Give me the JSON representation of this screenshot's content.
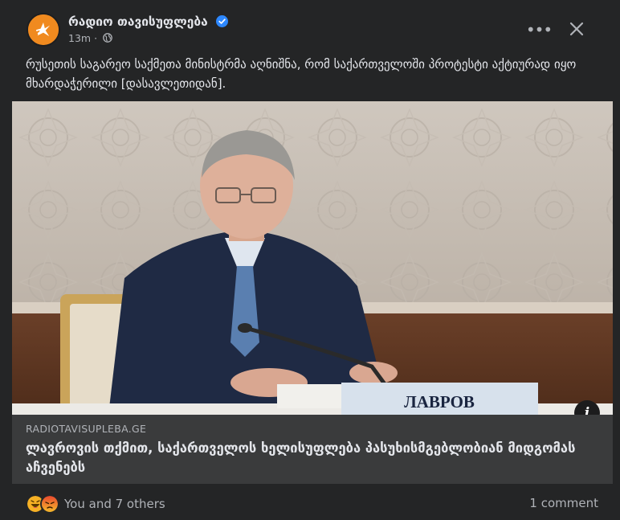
{
  "post": {
    "page_name": "რადიო თავისუფლება",
    "time": "13m",
    "privacy_icon": "globe-icon",
    "text": "რუსეთის საგარეო საქმეთა მინისტრმა აღნიშნა, რომ საქართველოში პროტესტი აქტიურად იყო მხარდაჭერილი [დასავლეთიდან].",
    "more_label": "•••",
    "close_label": "✕"
  },
  "photo": {
    "nameplate": "ЛАВРОВ",
    "info_label": "i"
  },
  "link": {
    "domain": "RADIOTAVISUPLEBA.GE",
    "headline": "ლავროვის თქმით, საქართველოს ხელისუფლება პასუხისმგებლობიან მიდგომას აჩვენებს"
  },
  "footer": {
    "reactions_text": "You and 7 others",
    "comments": "1 comment"
  },
  "colors": {
    "background": "#242526",
    "text_primary": "#e4e6eb",
    "text_secondary": "#b0b3b8",
    "link_box": "#3a3b3c",
    "avatar": "#f08a1f",
    "verified": "#2d88ff"
  }
}
